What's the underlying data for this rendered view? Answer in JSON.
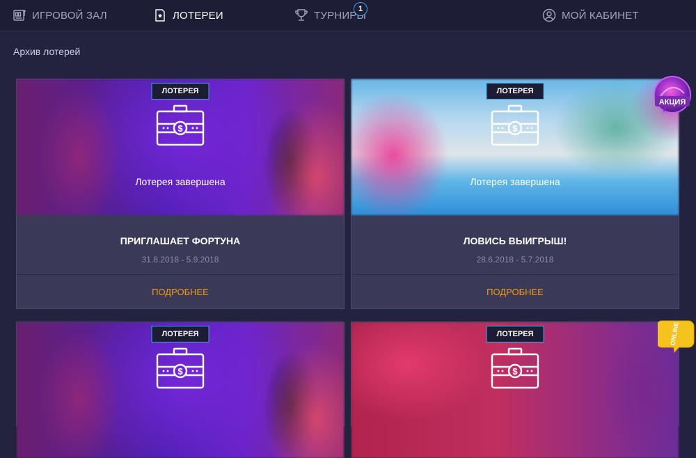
{
  "nav": {
    "items": [
      {
        "label": "ИГРОВОЙ ЗАЛ",
        "icon": "slot-machine-icon",
        "active": false
      },
      {
        "label": "ЛОТЕРЕИ",
        "icon": "ticket-icon",
        "active": true
      },
      {
        "label": "ТУРНИРЫ",
        "icon": "trophy-icon",
        "active": false,
        "badge": "1"
      },
      {
        "label": "МОЙ КАБИНЕТ",
        "icon": "user-icon",
        "active": false
      }
    ]
  },
  "section_title": "Архив лотерей",
  "cards": [
    {
      "tag": "ЛОТЕРЕЯ",
      "status": "Лотерея завершена",
      "title": "ПРИГЛАШАЕТ ФОРТУНА",
      "dates": "31.8.2018 - 5.9.2018",
      "link": "ПОДРОБНЕЕ"
    },
    {
      "tag": "ЛОТЕРЕЯ",
      "status": "Лотерея завершена",
      "title": "ЛОВИСЬ ВЫИГРЫШ!",
      "dates": "28.6.2018 - 5.7.2018",
      "link": "ПОДРОБНЕЕ"
    },
    {
      "tag": "ЛОТЕРЕЯ"
    },
    {
      "tag": "ЛОТЕРЕЯ"
    }
  ],
  "promo": {
    "akcia": "АКЦИЯ",
    "online": "ONLINE"
  },
  "colors": {
    "background": "#23233f",
    "nav_bg": "#1d1d35",
    "card_bg": "#3a3a58",
    "accent_blue": "#3fa8e8",
    "link_orange": "#f39a1c"
  }
}
